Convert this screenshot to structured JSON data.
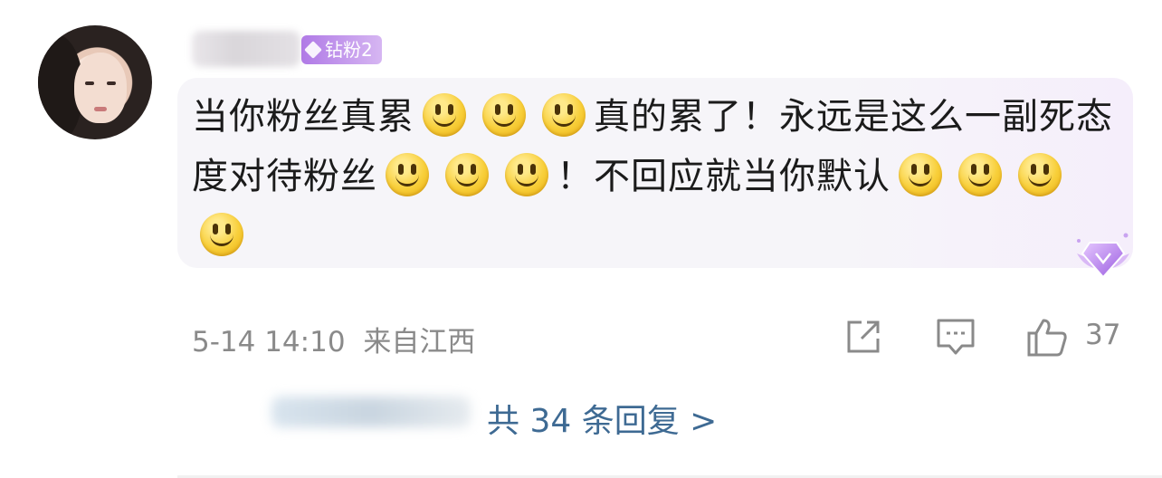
{
  "comment": {
    "badge_label": "钻粉2",
    "segment_1": "当你粉丝真累",
    "segment_2": "真的累了！永远是这么一副死态度对待粉丝",
    "segment_3": "！不回应就当你默认",
    "emoji_name": "smile-emoji",
    "meta": {
      "time": "5-14 14:10",
      "location": "来自江西"
    },
    "actions": {
      "share_icon": "share-icon",
      "reply_icon": "comment-icon",
      "like_icon": "thumbs-up-icon",
      "like_count": "37"
    },
    "replies_link": "共 34 条回复 >"
  },
  "colors": {
    "badge": "#b07ae6",
    "link": "#3e6a93",
    "meta": "#8a8a8a"
  }
}
